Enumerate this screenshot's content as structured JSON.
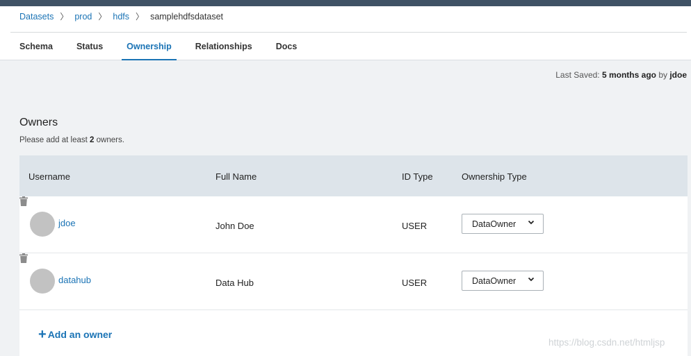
{
  "breadcrumb": {
    "items": [
      "Datasets",
      "prod",
      "hdfs"
    ],
    "current": "samplehdfsdataset",
    "separator": "〉"
  },
  "tabs": [
    {
      "label": "Schema",
      "active": false
    },
    {
      "label": "Status",
      "active": false
    },
    {
      "label": "Ownership",
      "active": true
    },
    {
      "label": "Relationships",
      "active": false
    },
    {
      "label": "Docs",
      "active": false
    }
  ],
  "last_saved": {
    "prefix": "Last Saved: ",
    "when": "5 months ago",
    "by_word": " by ",
    "user": "jdoe"
  },
  "owners": {
    "title": "Owners",
    "hint_prefix": "Please add at least ",
    "hint_count": "2",
    "hint_suffix": " owners.",
    "columns": {
      "username": "Username",
      "full_name": "Full Name",
      "id_type": "ID Type",
      "ownership_type": "Ownership Type"
    },
    "rows": [
      {
        "username": "jdoe",
        "full_name": "John Doe",
        "id_type": "USER",
        "ownership_type": "DataOwner"
      },
      {
        "username": "datahub",
        "full_name": "Data Hub",
        "id_type": "USER",
        "ownership_type": "DataOwner"
      }
    ],
    "add_label": "Add an owner",
    "add_icon": "+"
  },
  "watermark": "https://blog.csdn.net/htmljsp",
  "colors": {
    "accent": "#1a73b5",
    "topbar": "#3f5265",
    "header_row": "#dde4ea",
    "background": "#f0f2f4"
  }
}
